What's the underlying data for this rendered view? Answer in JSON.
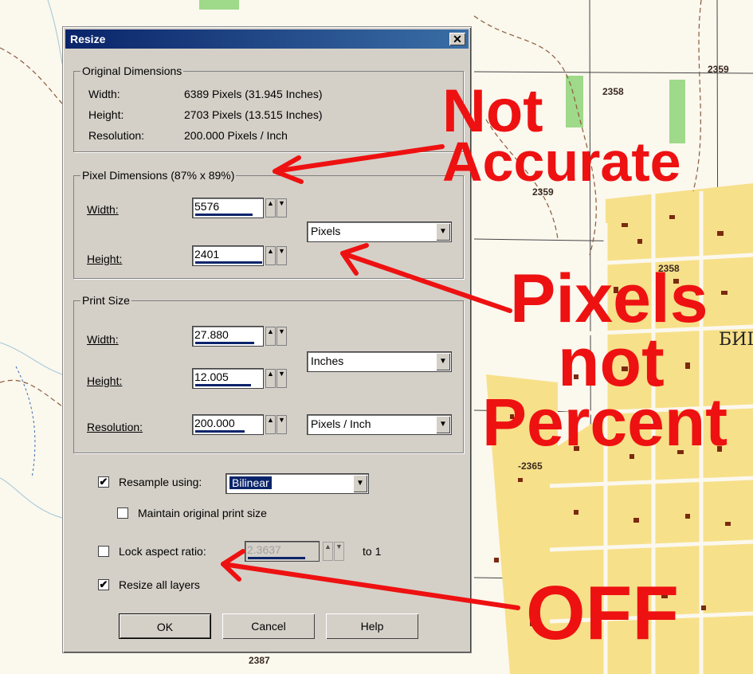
{
  "dialog": {
    "title": "Resize",
    "close_glyph": "✕",
    "original": {
      "legend": "Original Dimensions",
      "rows": [
        {
          "label": "Width:",
          "value": "6389 Pixels (31.945 Inches)"
        },
        {
          "label": "Height:",
          "value": "2703 Pixels (13.515 Inches)"
        },
        {
          "label": "Resolution:",
          "value": "200.000 Pixels / Inch"
        }
      ]
    },
    "pixel_dims": {
      "legend": "Pixel Dimensions (87% x 89%)",
      "width_label": "Width:",
      "width_value": "5576",
      "height_label": "Height:",
      "height_value": "2401",
      "unit": "Pixels"
    },
    "print_size": {
      "legend": "Print Size",
      "width_label": "Width:",
      "width_value": "27.880",
      "height_label": "Height:",
      "height_value": "12.005",
      "unit": "Inches",
      "resolution_label": "Resolution:",
      "resolution_value": "200.000",
      "resolution_unit": "Pixels / Inch"
    },
    "resample": {
      "checked": true,
      "label": "Resample using:",
      "method": "Bilinear"
    },
    "maintain": {
      "checked": false,
      "label": "Maintain original print size"
    },
    "lock": {
      "checked": false,
      "label": "Lock aspect ratio:",
      "value": "2.3637",
      "suffix": "to 1"
    },
    "resize_layers": {
      "checked": true,
      "label": "Resize all layers"
    },
    "buttons": {
      "ok": "OK",
      "cancel": "Cancel",
      "help": "Help"
    },
    "check_glyph": "✔",
    "spin_up": "▲",
    "spin_down": "▼",
    "dropdown_arrow": "▼"
  },
  "annotations": {
    "not": "Not",
    "accurate": "Accurate",
    "pixels": "Pixels",
    "not2": "not",
    "percent": "Percent",
    "off": "OFF",
    "color": "#ee1111"
  },
  "map": {
    "labels": [
      "2358",
      "2359",
      "2359",
      "2358",
      "-2365",
      "2387",
      "БИІ"
    ],
    "colors": {
      "background": "#fbf8ee",
      "blocks": "#f7e08a",
      "buildings": "#7a2a10",
      "forest": "#9fd98a"
    }
  }
}
